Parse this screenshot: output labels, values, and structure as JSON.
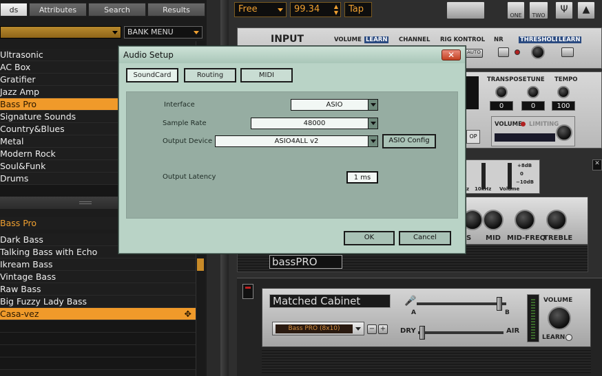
{
  "browser": {
    "tabs": [
      "ds",
      "Attributes",
      "Search",
      "Results"
    ],
    "bank_menu": "BANK MENU",
    "banks": [
      "Ultrasonic",
      "AC Box",
      "Gratifier",
      "Jazz Amp",
      "Bass Pro",
      "Signature Sounds",
      "Country&Blues",
      "Metal",
      "Modern Rock",
      "Soul&Funk",
      "Drums"
    ],
    "selected_bank": "Bass Pro",
    "preset_header": "Bass Pro",
    "presets": [
      "Dark Bass",
      "Talking Bass with Echo",
      "Ikream Bass",
      "Vintage Bass",
      "Raw Bass",
      "Big Fuzzy Lady Bass",
      "Casa-vez"
    ],
    "selected_preset": "Casa-vez"
  },
  "transport": {
    "mode": "Free",
    "tempo": "99.34",
    "tap": "Tap",
    "view_one": "ONE",
    "view_two": "TWO"
  },
  "input_panel": {
    "title": "INPUT",
    "volume": "VOLUME",
    "learn": "LEARN",
    "channel": "CHANNEL",
    "rig_kontrol": "RIG KONTROL",
    "nr": "NR",
    "threshold": "THRESHOLD",
    "learn2": "LEARN",
    "auto": "AUTO"
  },
  "tuner_panel": {
    "transpose_label": "TRANSPOSE",
    "tune_label": "TUNE",
    "tempo_label": "TEMPO",
    "transpose": "0",
    "tune": "0",
    "tempo": "100",
    "volume_label": "VOLUME",
    "limiting": "LIMITING",
    "op": "OP"
  },
  "eq_panel": {
    "plus8": "+8dB",
    "zero": "0",
    "minus10": "−10dB",
    "freq": "10kHz",
    "volume": "Volume",
    "z": "z"
  },
  "amp": {
    "knob_labels": [
      "S",
      "MID",
      "MID-FREQ",
      "TREBLE"
    ],
    "brand": "bassPRO"
  },
  "cabinet": {
    "title": "Matched Cabinet",
    "preset": "Bass PRO (8x10)",
    "minus": "−",
    "plus": "+",
    "a": "A",
    "b": "B",
    "dry": "DRY",
    "air": "AIR",
    "volume": "VOLUME",
    "learn": "LEARN"
  },
  "dialog": {
    "title": "Audio Setup",
    "close": "✕",
    "tabs": [
      "SoundCard",
      "Routing",
      "MIDI"
    ],
    "active_tab": "SoundCard",
    "interface_label": "Interface",
    "interface_value": "ASIO",
    "sample_rate_label": "Sample Rate",
    "sample_rate_value": "48000",
    "output_device_label": "Output Device",
    "output_device_value": "ASIO4ALL v2",
    "asio_config": "ASIO Config",
    "output_latency_label": "Output Latency",
    "output_latency_value": "1 ms",
    "ok": "OK",
    "cancel": "Cancel"
  }
}
